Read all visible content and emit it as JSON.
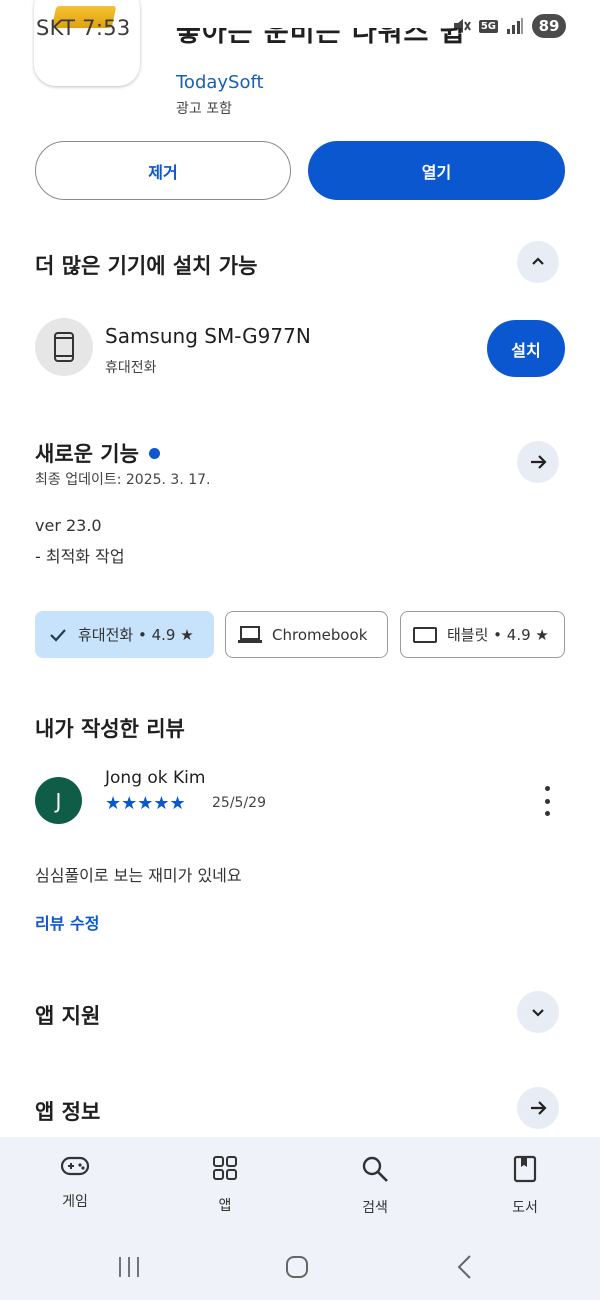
{
  "status_bar": {
    "carrier_time": "SKT 7:53",
    "network_badge": "5G",
    "battery": "89",
    "icons": [
      "mute-icon",
      "5g-icon",
      "signal-icon",
      "battery-icon"
    ]
  },
  "app": {
    "title_partial": "좋아는 운비는 다워즈 쉽",
    "developer": "TodaySoft",
    "ad_label": "광고 포함"
  },
  "actions": {
    "remove_label": "제거",
    "open_label": "열기"
  },
  "more_devices": {
    "title": "더 많은 기기에 설치 가능",
    "device_name": "Samsung SM-G977N",
    "device_type": "휴대전화",
    "install_label": "설치"
  },
  "whats_new": {
    "title": "새로운 기능",
    "updated": "최종 업데이트: 2025. 3. 17.",
    "version": "ver 23.0",
    "note": "- 최적화 작업"
  },
  "device_chips": [
    {
      "label": "휴대전화 • 4.9 ★",
      "selected": true,
      "icon": "check-icon"
    },
    {
      "label": "Chromebook",
      "selected": false,
      "icon": "laptop-icon"
    },
    {
      "label": "태블릿 • 4.9 ★",
      "selected": false,
      "icon": "tablet-icon"
    }
  ],
  "my_review": {
    "title": "내가 작성한 리뷰",
    "avatar_letter": "J",
    "reviewer": "Jong ok Kim",
    "stars": "★★★★★",
    "rating": 5,
    "date": "25/5/29",
    "text": "심심풀이로 보는 재미가 있네요",
    "edit_label": "리뷰 수정"
  },
  "sections": {
    "app_support": "앱 지원",
    "app_info": "앱 정보"
  },
  "bottom_nav": {
    "games": "게임",
    "apps": "앱",
    "search": "검색",
    "books": "도서"
  },
  "colors": {
    "accent": "#0b57d0",
    "chip_selected": "#c7e3fb",
    "nav_bg": "#eff3f9",
    "avatar": "#0f5c47"
  }
}
